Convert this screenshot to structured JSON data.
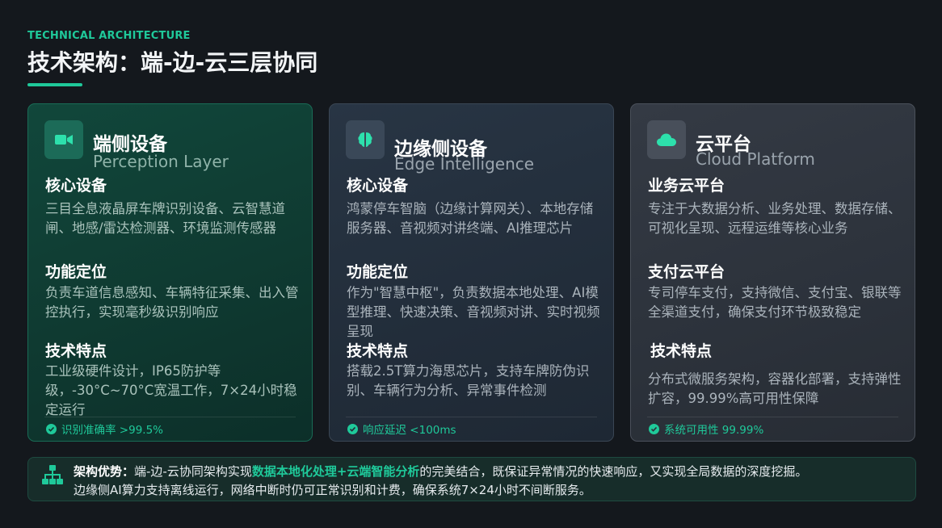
{
  "header": {
    "eyebrow": "TECHNICAL ARCHITECTURE",
    "title": "技术架构：端-边-云三层协同"
  },
  "cards": [
    {
      "icon": "video-camera-icon",
      "title": "端侧设备",
      "subtitle": "Perception Layer",
      "sections": [
        {
          "heading": "核心设备",
          "text": "三目全息液晶屏车牌识别设备、云智慧道闸、地感/雷达检测器、环境监测传感器"
        },
        {
          "heading": "功能定位",
          "text": "负责车道信息感知、车辆特征采集、出入管控执行，实现毫秒级识别响应"
        },
        {
          "heading": "技术特点",
          "text": "工业级硬件设计，IP65防护等级，-30°C~70°C宽温工作，7×24小时稳定运行"
        }
      ],
      "footer": "识别准确率 >99.5%"
    },
    {
      "icon": "brain-icon",
      "title": "边缘侧设备",
      "subtitle": "Edge Intelligence",
      "sections": [
        {
          "heading": "核心设备",
          "text": "鸿蒙停车智脑（边缘计算网关）、本地存储服务器、音视频对讲终端、AI推理芯片"
        },
        {
          "heading": "功能定位",
          "text": "作为\"智慧中枢\"，负责数据本地处理、AI模型推理、快速决策、音视频对讲、实时视频呈现"
        },
        {
          "heading": "技术特点",
          "text": "搭载2.5T算力海思芯片，支持车牌防伪识别、车辆行为分析、异常事件检测"
        }
      ],
      "footer": "响应延迟 <100ms"
    },
    {
      "icon": "cloud-icon",
      "title": "云平台",
      "subtitle": "Cloud Platform",
      "sections": [
        {
          "heading": "业务云平台",
          "text": "专注于大数据分析、业务处理、数据存储、可视化呈现、远程运维等核心业务"
        },
        {
          "heading": "支付云平台",
          "text": "专司停车支付，支持微信、支付宝、银联等全渠道支付，确保支付环节极致稳定"
        },
        {
          "heading": "技术特点",
          "text": "分布式微服务架构，容器化部署，支持弹性扩容，99.99%高可用性保障"
        }
      ],
      "footer": "系统可用性 99.99%"
    }
  ],
  "banner": {
    "icon": "network-icon",
    "label": "架构优势：",
    "text_before": "端-边-云协同架构实现",
    "highlight": "数据本地化处理+云端智能分析",
    "text_after": "的完美结合，既保证异常情况的快速响应，又实现全局数据的深度挖掘。",
    "line2": "边缘侧AI算力支持离线运行，网络中断时仍可正常识别和计费，确保系统7×24小时不间断服务。"
  },
  "colors": {
    "accent": "#1fc99a",
    "background": "#14181d"
  }
}
